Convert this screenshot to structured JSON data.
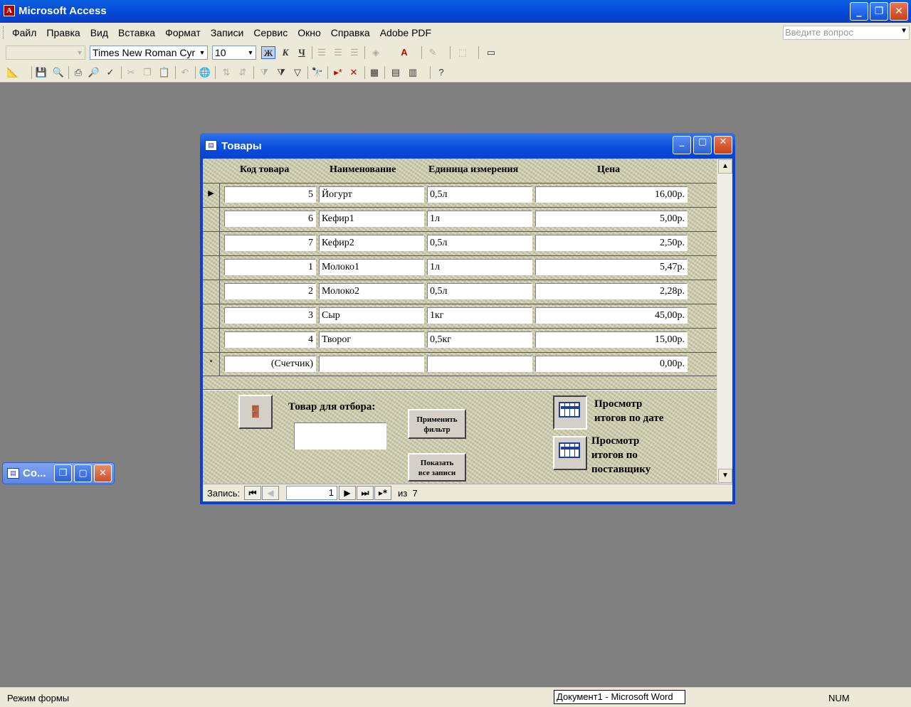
{
  "window": {
    "title": "Microsoft Access"
  },
  "menu": [
    "Файл",
    "Правка",
    "Вид",
    "Вставка",
    "Формат",
    "Записи",
    "Сервис",
    "Окно",
    "Справка",
    "Adobe PDF"
  ],
  "ask_placeholder": "Введите вопрос",
  "format_toolbar": {
    "object_combo": "",
    "font": "Times New Roman Cyr",
    "size": "10",
    "bold": "Ж",
    "italic": "К",
    "underline": "Ч"
  },
  "form": {
    "title": "Товары",
    "columns": [
      "Код товара",
      "Наименование",
      "Единица измерения",
      "Цена"
    ],
    "rows": [
      {
        "code": "5",
        "name": "Йогурт",
        "unit": "0,5л",
        "price": "16,00р."
      },
      {
        "code": "6",
        "name": "Кефир1",
        "unit": "1л",
        "price": "5,00р."
      },
      {
        "code": "7",
        "name": "Кефир2",
        "unit": "0,5л",
        "price": "2,50р."
      },
      {
        "code": "1",
        "name": "Молоко1",
        "unit": "1л",
        "price": "5,47р."
      },
      {
        "code": "2",
        "name": "Молоко2",
        "unit": "0,5л",
        "price": "2,28р."
      },
      {
        "code": "3",
        "name": "Сыр",
        "unit": "1кг",
        "price": "45,00р."
      },
      {
        "code": "4",
        "name": "Творог",
        "unit": "0,5кг",
        "price": "15,00р."
      }
    ],
    "new_row": {
      "marker": "*",
      "code": "(Счетчик)",
      "name": "",
      "unit": "",
      "price": "0,00р."
    },
    "current_marker": "▶",
    "filter_label": "Товар для отбора:",
    "filter_value": "",
    "apply_filter_l1": "Применить",
    "apply_filter_l2": "фильтр",
    "show_all_l1": "Показать",
    "show_all_l2": "все записи",
    "totals_date_l1": "Просмотр",
    "totals_date_l2": "итогов по дате",
    "totals_supplier_l1": "Просмотр",
    "totals_supplier_l2": "итогов по",
    "totals_supplier_l3": "поставщику",
    "nav": {
      "label": "Запись:",
      "current": "1",
      "of_label": "из",
      "total": "7"
    }
  },
  "minimized_window": {
    "title": "Со..."
  },
  "status": {
    "mode": "Режим формы",
    "task": "Документ1 - Microsoft Word",
    "num": "NUM"
  }
}
